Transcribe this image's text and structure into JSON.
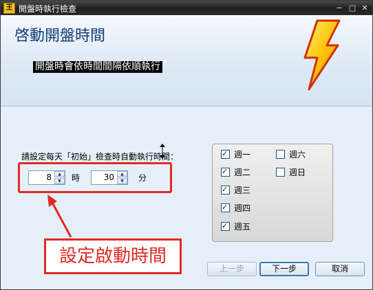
{
  "window": {
    "title": "開盤時執行檢查",
    "icon_text": "王",
    "controls": [
      "minimize-icon",
      "maximize-icon",
      "close-icon"
    ]
  },
  "header": {
    "heading": "啓動開盤時間",
    "subtitle": "開盤時會依時間間隔依順執行"
  },
  "form": {
    "instruction": "請設定每天「初始」檢查時自動執行時間：",
    "hour_value": "8",
    "hour_unit": "時",
    "minute_value": "30",
    "minute_unit": "分"
  },
  "days": [
    {
      "label": "週一",
      "checked": true
    },
    {
      "label": "週二",
      "checked": true
    },
    {
      "label": "週三",
      "checked": true
    },
    {
      "label": "週四",
      "checked": true
    },
    {
      "label": "週五",
      "checked": true
    },
    {
      "label": "週六",
      "checked": false
    },
    {
      "label": "週日",
      "checked": false
    }
  ],
  "annotation": {
    "callout_text": "設定啟動時間",
    "color": "#e02a24"
  },
  "buttons": {
    "prev": "上一步",
    "next": "下一步",
    "cancel": "取消"
  }
}
